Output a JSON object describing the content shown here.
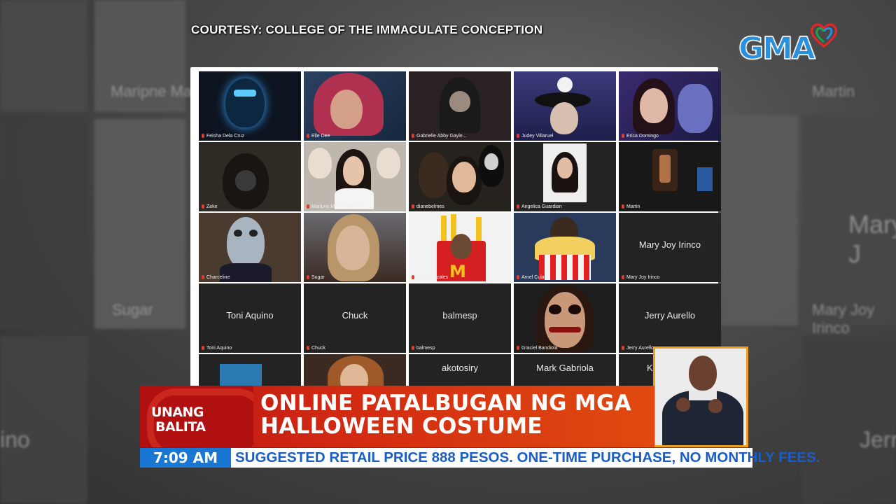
{
  "overlay": {
    "courtesy": "COURTESY:  COLLEGE OF THE IMMACULATE CONCEPTION",
    "logo_text": "GMA"
  },
  "background": {
    "blurred_labels": [
      "Maripne Mae",
      "Martin",
      "Mary J",
      "Sugar",
      "Mary Joy Irinco",
      "ino",
      "Jerry"
    ]
  },
  "zoom_grid": {
    "tiles": [
      {
        "name": "Feisha Dela Cruz",
        "center": ""
      },
      {
        "name": "Elle Dee",
        "center": ""
      },
      {
        "name": "Gabrielle Abby Gayle...",
        "center": ""
      },
      {
        "name": "Judey Villaruel",
        "center": ""
      },
      {
        "name": "Erica Domingo",
        "center": ""
      },
      {
        "name": "Zeke",
        "center": ""
      },
      {
        "name": "Maripne Mae Enriquez",
        "center": ""
      },
      {
        "name": "dianebelmes",
        "center": ""
      },
      {
        "name": "Angelica Guardian",
        "center": ""
      },
      {
        "name": "Martin",
        "center": ""
      },
      {
        "name": "Charceline",
        "center": ""
      },
      {
        "name": "Sugar",
        "center": ""
      },
      {
        "name": "Jere Gonzales",
        "center": ""
      },
      {
        "name": "Arnel Culala",
        "center": ""
      },
      {
        "name": "Mary Joy Irinco",
        "center": "Mary Joy Irinco"
      },
      {
        "name": "Toni Aquino",
        "center": "Toni Aquino"
      },
      {
        "name": "Chuck",
        "center": "Chuck"
      },
      {
        "name": "balmesp",
        "center": "balmesp"
      },
      {
        "name": "Graciel Bandiola",
        "center": ""
      },
      {
        "name": "Jerry Aurello",
        "center": "Jerry Aurello"
      },
      {
        "name": "",
        "center": ""
      },
      {
        "name": "",
        "center": ""
      },
      {
        "name": "",
        "center": "akotosiry"
      },
      {
        "name": "",
        "center": "Mark Gabriola"
      },
      {
        "name": "",
        "center": "Ka"
      }
    ]
  },
  "lower_third": {
    "show_line1": "UNANG",
    "show_line2": "BALITA",
    "headline_line1": "ONLINE PATALBUGAN NG MGA",
    "headline_line2": "HALLOWEEN COSTUME",
    "time": "7:09 AM",
    "ticker": "SUGGESTED RETAIL PRICE 888 PESOS. ONE-TIME PURCHASE, NO MONTHLY FEES."
  },
  "colors": {
    "lower_third_red": "#c81a14",
    "ticker_blue": "#1877d2",
    "ticker_text": "#1a5ec4",
    "interpreter_border": "#f0a020",
    "logo_blue": "#2a8fdc"
  }
}
